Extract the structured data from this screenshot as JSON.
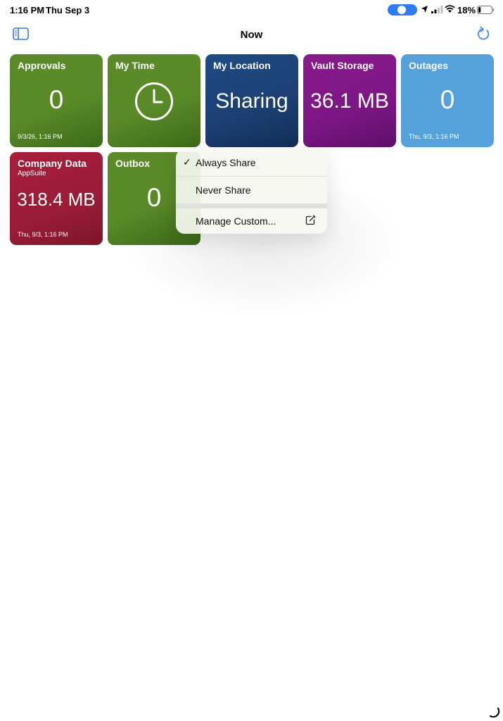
{
  "status_bar": {
    "time": "1:16 PM",
    "date": "Thu Sep 3",
    "battery_percent": "18%",
    "battery_level": 0.18,
    "icons": [
      "navigation-pill-icon",
      "location-arrow-icon",
      "cellular-signal-icon",
      "wifi-icon",
      "battery-icon"
    ]
  },
  "nav": {
    "title": "Now",
    "left_icon": "sidebar-toggle-icon",
    "right_icon": "refresh-icon",
    "accent_color": "#2f7bf5"
  },
  "tiles": [
    {
      "title": "Approvals",
      "value": "0",
      "date": "9/3/26, 1:16 PM",
      "color": "#5a8a27"
    },
    {
      "title": "My Time",
      "icon": "clock-icon",
      "color": "#5a8a27"
    },
    {
      "title": "My Location",
      "value": "Sharing",
      "color": "#1b3f72"
    },
    {
      "title": "Vault Storage",
      "value": "36.1 MB",
      "color": "#7c1684"
    },
    {
      "title": "Outages",
      "value": "0",
      "date": "Thu, 9/3, 1:16 PM",
      "color": "#54a1dc"
    },
    {
      "title": "Company Data",
      "subtitle": "AppSuite",
      "value": "318.4 MB",
      "date": "Thu, 9/3, 1:16 PM",
      "color": "#9a1c37"
    },
    {
      "title": "Outbox",
      "value": "0",
      "color": "#5a8a27"
    }
  ],
  "context_menu": {
    "items": [
      {
        "label": "Always Share",
        "checked": true
      },
      {
        "label": "Never Share",
        "checked": false
      },
      {
        "label": "Manage Custom...",
        "icon": "edit-square-icon"
      }
    ]
  }
}
